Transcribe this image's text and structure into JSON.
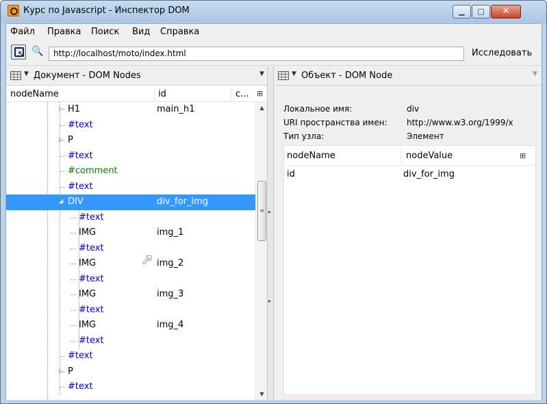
{
  "window": {
    "title": "Курс по Javascript - Инспектор DOM"
  },
  "menu": [
    "Файл",
    "Правка",
    "Поиск",
    "Вид",
    "Справка"
  ],
  "toolbar": {
    "url": "http://localhost/moto/index.html",
    "inspect_label": "Исследовать"
  },
  "left_panel": {
    "title": "Документ - DOM Nodes",
    "columns": [
      "nodeName",
      "id",
      "c..."
    ]
  },
  "tree_rows": [
    {
      "name": "H1",
      "id": "main_h1",
      "kind": "element",
      "depth": 0,
      "twisty": "▷"
    },
    {
      "name": "#text",
      "id": "",
      "kind": "text",
      "depth": 0
    },
    {
      "name": "P",
      "id": "",
      "kind": "element",
      "depth": 0,
      "twisty": "▷"
    },
    {
      "name": "#text",
      "id": "",
      "kind": "text",
      "depth": 0
    },
    {
      "name": "#comment",
      "id": "",
      "kind": "comment",
      "depth": 0
    },
    {
      "name": "#text",
      "id": "",
      "kind": "text",
      "depth": 0
    },
    {
      "name": "DIV",
      "id": "div_for_img",
      "kind": "element",
      "depth": 0,
      "twisty": "◢",
      "selected": true
    },
    {
      "name": "#text",
      "id": "",
      "kind": "text",
      "depth": 1
    },
    {
      "name": "IMG",
      "id": "img_1",
      "kind": "element",
      "depth": 1
    },
    {
      "name": "#text",
      "id": "",
      "kind": "text",
      "depth": 1
    },
    {
      "name": "IMG",
      "id": "img_2",
      "kind": "element",
      "depth": 1
    },
    {
      "name": "#text",
      "id": "",
      "kind": "text",
      "depth": 1
    },
    {
      "name": "IMG",
      "id": "img_3",
      "kind": "element",
      "depth": 1
    },
    {
      "name": "#text",
      "id": "",
      "kind": "text",
      "depth": 1
    },
    {
      "name": "IMG",
      "id": "img_4",
      "kind": "element",
      "depth": 1
    },
    {
      "name": "#text",
      "id": "",
      "kind": "text",
      "depth": 1
    },
    {
      "name": "#text",
      "id": "",
      "kind": "text",
      "depth": 0
    },
    {
      "name": "P",
      "id": "",
      "kind": "element",
      "depth": 0,
      "twisty": "▷"
    },
    {
      "name": "#text",
      "id": "",
      "kind": "text",
      "depth": 0
    }
  ],
  "right_panel": {
    "title": "Объект - DOM Node",
    "props": [
      {
        "label": "Локальное имя:",
        "value": "div"
      },
      {
        "label": "URI пространства имен:",
        "value": "http://www.w3.org/1999/x"
      },
      {
        "label": "Тип узла:",
        "value": "Элемент"
      }
    ],
    "attr_columns": [
      "nodeName",
      "nodeValue"
    ],
    "attributes": [
      {
        "name": "id",
        "value": "div_for_img"
      }
    ]
  },
  "colors": {
    "selection": "#3399ff",
    "text_node": "#0000cc",
    "comment_node": "#008000"
  }
}
